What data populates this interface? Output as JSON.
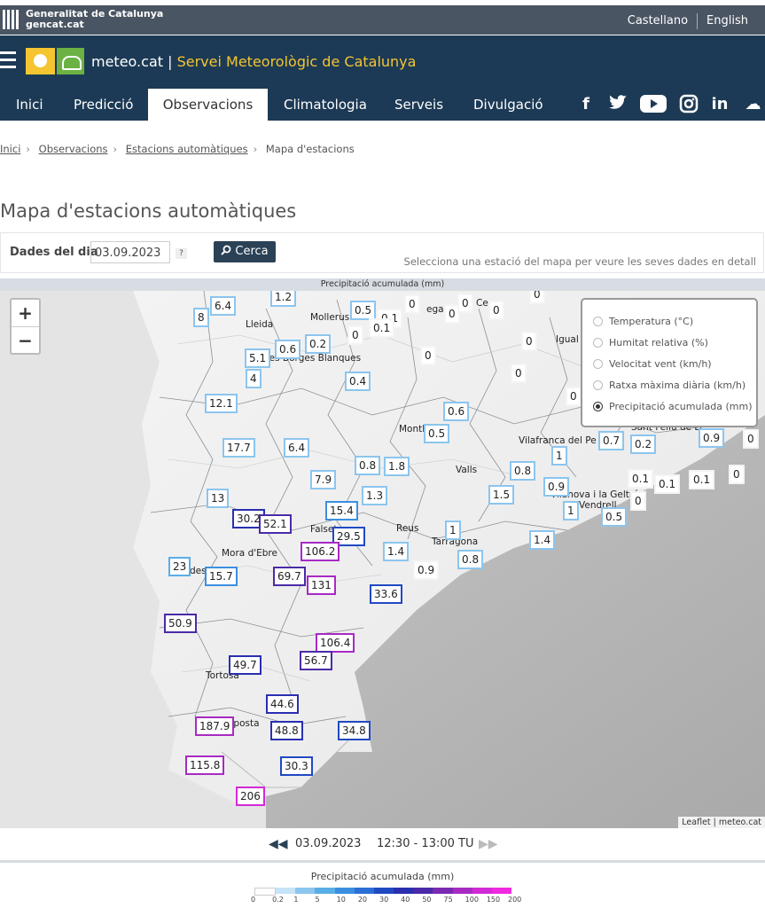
{
  "top": {
    "gencat_line1": "Generalitat de Catalunya",
    "gencat_line2": "gencat.cat",
    "lang_es": "Castellano",
    "lang_en": "English"
  },
  "brand": {
    "site": "meteo.cat",
    "sep": "|",
    "service": "Servei Meteorològic de Catalunya"
  },
  "nav": [
    "Inici",
    "Predicció",
    "Observacions",
    "Climatologia",
    "Serveis",
    "Divulgació"
  ],
  "social": {
    "facebook": "f",
    "twitter": "t",
    "youtube": "▶",
    "instagram": "◎",
    "linkedin": "in",
    "soundcloud": "☁"
  },
  "breadcrumb": [
    "Inici",
    "Observacions",
    "Estacions automàtiques",
    "Mapa d'estacions"
  ],
  "page_title": "Mapa d'estacions automàtiques",
  "form": {
    "label": "Dades del dia",
    "date": "03.09.2023",
    "help": "?",
    "search": "Cerca",
    "hint": "Selecciona una estació del mapa per veure les seves dades en detall"
  },
  "map": {
    "header": "Precipitació acumulada (mm)",
    "zoom_in": "+",
    "zoom_out": "−",
    "layers": [
      "Temperatura (°C)",
      "Humitat relativa (%)",
      "Velocitat vent (km/h)",
      "Ratxa màxima diària (km/h)",
      "Precipitació acumulada (mm)"
    ],
    "selected_layer": "Precipitació acumulada (mm)",
    "attribution": "Leaflet | meteo.cat",
    "places": [
      "Lleida",
      "Mollerus",
      "Les Borges Blanques",
      "Montb",
      "Valls",
      "Reus",
      "Tarragona",
      "Falset",
      "Mora d'Ebre",
      "Tortosa",
      "Amposta",
      "Vilafranca del Pe",
      "Sant Feliu de Ll",
      "Vilanova i la Geltrú",
      "Vendrell",
      "Igual",
      "Cerv",
      "ega",
      "des"
    ],
    "stations": [
      "1.2",
      "6.4",
      "8",
      "0.5",
      "0.1",
      "0",
      "0",
      "0",
      "0",
      "0",
      "0.1",
      "0",
      "0",
      "0",
      "5.1",
      "0.6",
      "0.2",
      "0",
      "4",
      "0",
      "0.4",
      "12.1",
      "0.6",
      "0.5",
      "0.7",
      "0.2",
      "0.9",
      "0",
      "17.7",
      "6.4",
      "0.8",
      "1.8",
      "1",
      "0",
      "7.9",
      "0.8",
      "0.1",
      "0.1",
      "0.1",
      "0",
      "1.3",
      "1.5",
      "0.9",
      "13",
      "15.4",
      "1",
      "0.5",
      "30.2",
      "52.1",
      "29.5",
      "1.4",
      "1",
      "1.4",
      "23",
      "106.2",
      "0.8",
      "0.9",
      "15.7",
      "69.7",
      "131",
      "33.6",
      "50.9",
      "106.4",
      "56.7",
      "49.7",
      "44.6",
      "187.9",
      "48.8",
      "34.8",
      "115.8",
      "30.3",
      "206"
    ]
  },
  "timebar": {
    "prev": "◀◀",
    "date": "03.09.2023",
    "range": "12:30 - 13:00 TU",
    "next": "▶▶"
  },
  "scale": {
    "title": "Precipitació acumulada (mm)",
    "ticks": [
      "0",
      "0.2",
      "1",
      "5",
      "10",
      "20",
      "30",
      "40",
      "50",
      "75",
      "100",
      "150",
      "200"
    ],
    "colors": [
      "#ffffff",
      "#c6e4f8",
      "#8cc5ee",
      "#5aaee8",
      "#3b8fe0",
      "#2b6fd6",
      "#2049c2",
      "#2a2fb0",
      "#4b2aa8",
      "#7a2ab2",
      "#a82ac4",
      "#d22ad6",
      "#f02ae0"
    ]
  }
}
